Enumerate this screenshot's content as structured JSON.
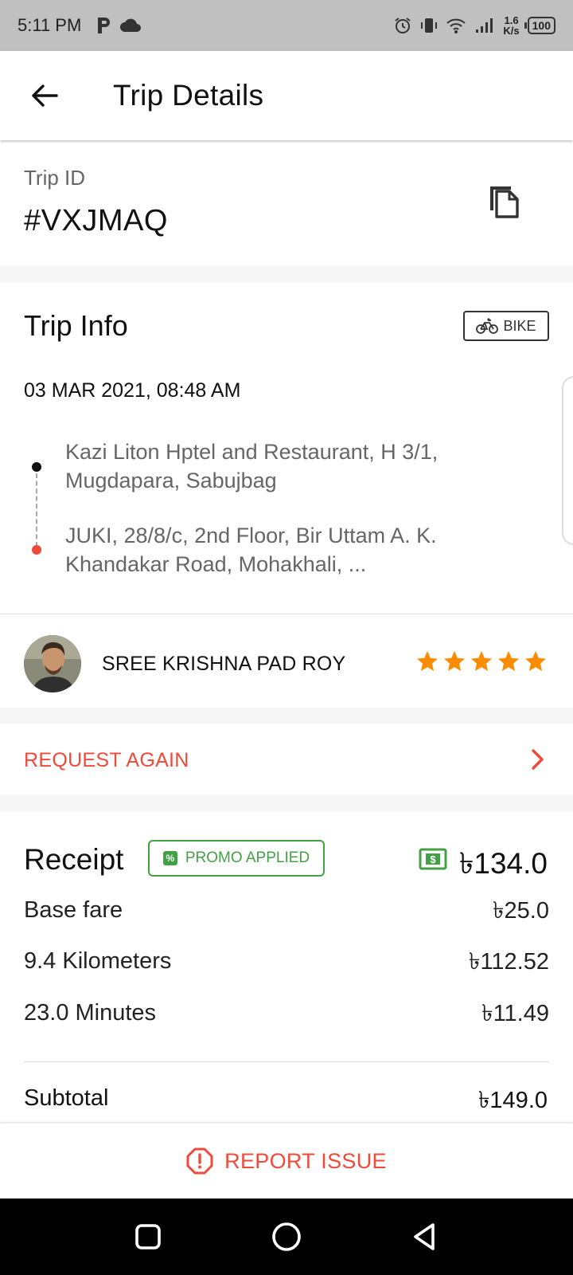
{
  "status_bar": {
    "time": "5:11 PM",
    "speed_value": "1.6",
    "speed_unit": "K/s",
    "battery": "100"
  },
  "header": {
    "title": "Trip Details"
  },
  "trip_id": {
    "label": "Trip ID",
    "value": "#VXJMAQ"
  },
  "trip_info": {
    "title": "Trip Info",
    "vehicle_type": "BIKE",
    "datetime": "03 MAR 2021, 08:48 AM",
    "pickup": "Kazi Liton Hptel and Restaurant, H 3/1, Mugdapara, Sabujbag",
    "dropoff": "JUKI, 28/8/c, 2nd Floor, Bir Uttam A. K. Khandakar Road, Mohakhali, ..."
  },
  "driver": {
    "name": "SREE KRISHNA PAD ROY",
    "rating": 5,
    "rating_max": 5
  },
  "request_again": {
    "label": "REQUEST AGAIN"
  },
  "receipt": {
    "title": "Receipt",
    "promo_label": "PROMO APPLIED",
    "total": "৳134.0",
    "items": [
      {
        "label": "Base fare",
        "value": "৳25.0"
      },
      {
        "label": "9.4 Kilometers",
        "value": "৳112.52"
      },
      {
        "label": "23.0 Minutes",
        "value": "৳11.49"
      }
    ],
    "subtotal_label": "Subtotal",
    "subtotal_value": "৳149.0"
  },
  "report": {
    "label": "REPORT ISSUE"
  },
  "colors": {
    "accent_red": "#f04a3a",
    "promo_green": "#43a047",
    "star_orange": "#fb8c00"
  }
}
